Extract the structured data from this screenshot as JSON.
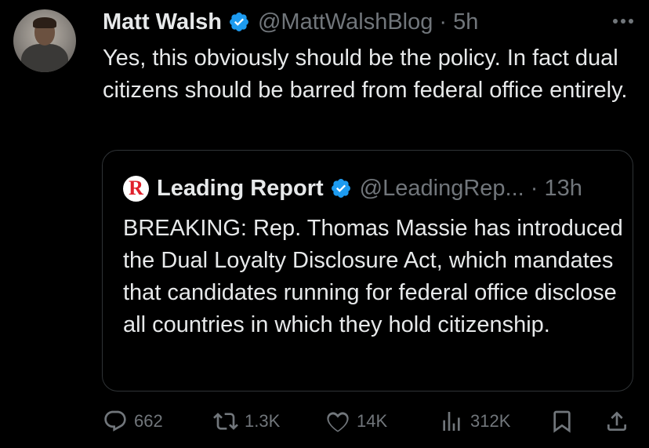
{
  "tweet": {
    "author_name": "Matt Walsh",
    "handle_time": "@MattWalshBlog · 5h",
    "text": "Yes, this obviously should be the policy. In fact dual citizens should be barred from federal office entirely."
  },
  "quote": {
    "logo_letter": "R",
    "author_name": "Leading Report",
    "handle_time": "@LeadingRep... · 13h",
    "text": "BREAKING: Rep. Thomas Massie has introduced the Dual Loyalty Disclosure Act, which mandates that candidates running for federal office disclose all countries in which they hold citizenship."
  },
  "actions": {
    "replies": "662",
    "reposts": "1.3K",
    "likes": "14K",
    "views": "312K"
  },
  "colors": {
    "background": "#000000",
    "text": "#e7e9ea",
    "secondary": "#71767b",
    "verified": "#1d9bf0",
    "border": "#2f3336",
    "logo_red": "#e0202b"
  },
  "icons": [
    "verified-badge-icon",
    "more-icon",
    "reply-icon",
    "repost-icon",
    "like-icon",
    "views-icon",
    "bookmark-icon",
    "share-icon"
  ]
}
